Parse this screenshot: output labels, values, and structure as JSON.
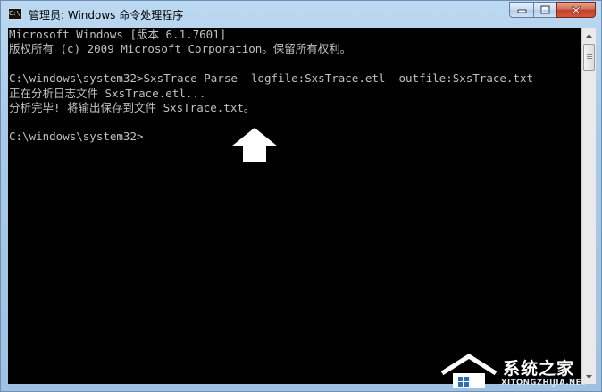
{
  "window": {
    "title": "管理员: Windows 命令处理程序",
    "icon_label": "C:\\."
  },
  "caption_buttons": {
    "minimize_icon": "minimize-icon",
    "maximize_icon": "maximize-icon",
    "close_icon": "close-icon"
  },
  "console": {
    "lines": [
      "Microsoft Windows [版本 6.1.7601]",
      "版权所有 (c) 2009 Microsoft Corporation。保留所有权利。",
      "",
      "C:\\windows\\system32>SxsTrace Parse -logfile:SxsTrace.etl -outfile:SxsTrace.txt",
      "正在分析日志文件 SxsTrace.etl...",
      "分析完毕! 将输出保存到文件 SxsTrace.txt。",
      "",
      "C:\\windows\\system32>"
    ],
    "text_color": "#c0c0c0",
    "background_color": "#000000"
  },
  "overlay": {
    "arrow_icon": "up-arrow-icon",
    "arrow_color": "#ffffff"
  },
  "watermark": {
    "brand": "系统之家",
    "url": "XITONGZHIJIA.NET"
  }
}
